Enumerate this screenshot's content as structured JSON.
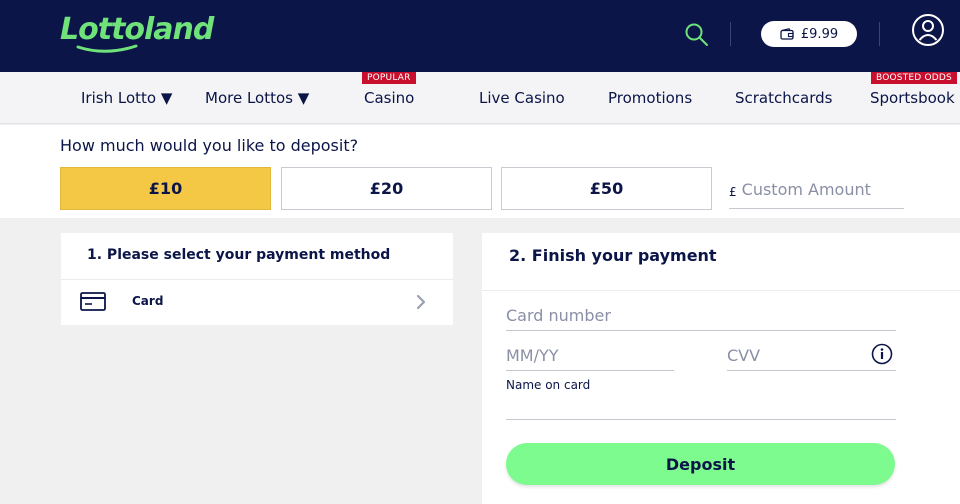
{
  "header": {
    "logo_text": "Lottoland",
    "wallet_balance": "£9.99",
    "brand_color": "#0b1548",
    "logo_color": "#6fe37a",
    "icons": [
      "search-icon",
      "wallet-icon",
      "user-account-icon"
    ]
  },
  "nav": {
    "items": [
      {
        "label": "Irish Lotto ▼",
        "badge": ""
      },
      {
        "label": "More Lottos ▼",
        "badge": ""
      },
      {
        "label": "Casino",
        "badge": "POPULAR"
      },
      {
        "label": "Live Casino",
        "badge": ""
      },
      {
        "label": "Promotions",
        "badge": ""
      },
      {
        "label": "Scratchcards",
        "badge": ""
      },
      {
        "label": "Sportsbook",
        "badge": "BOOSTED ODDS"
      }
    ],
    "badge_color": "#c8102e"
  },
  "deposit": {
    "question": "How much would you like to deposit?",
    "amounts": [
      {
        "label": "£10",
        "selected": true
      },
      {
        "label": "£20",
        "selected": false
      },
      {
        "label": "£50",
        "selected": false
      }
    ],
    "currency_symbol": "£",
    "custom_placeholder": "Custom Amount",
    "selected_color": "#f4c845"
  },
  "payment_method": {
    "title": "1. Please select your payment method",
    "option_label": "Card",
    "option_icon": "card-icon"
  },
  "finish_payment": {
    "title": "2. Finish your payment",
    "card_number_placeholder": "Card number",
    "expiry_placeholder": "MM/YY",
    "cvv_placeholder": "CVV",
    "name_label": "Name on card",
    "deposit_label": "Deposit",
    "deposit_color": "#7dfb8e"
  }
}
